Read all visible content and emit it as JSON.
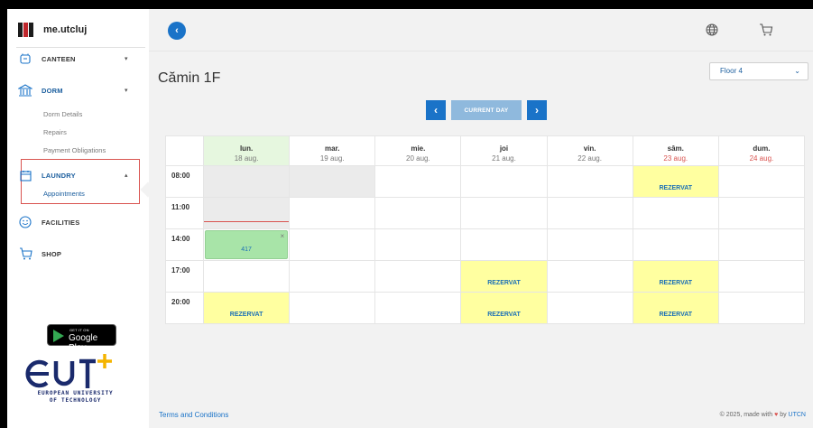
{
  "brand": {
    "name": "me.utcluj"
  },
  "sidebar": {
    "canteen": {
      "label": "CANTEEN"
    },
    "dorm": {
      "label": "DORM",
      "items": [
        "Dorm Details",
        "Repairs",
        "Payment Obligations"
      ]
    },
    "laundry": {
      "label": "LAUNDRY",
      "items": [
        "Appointments"
      ]
    },
    "facilities": {
      "label": "FACILITIES"
    },
    "shop": {
      "label": "SHOP"
    },
    "google_play": {
      "small": "GET IT ON",
      "big": "Google Play"
    },
    "eut": {
      "caption_line1": "EUROPEAN UNIVERSITY",
      "caption_line2": "OF TECHNOLOGY"
    }
  },
  "header": {
    "icons": [
      "back-icon",
      "globe-icon",
      "cart-icon"
    ]
  },
  "page": {
    "title": "Cămin 1F",
    "floor_select": {
      "value": "Floor 4"
    },
    "nav": {
      "current_day": "CURRENT DAY"
    }
  },
  "calendar": {
    "days": [
      {
        "name": "lun.",
        "date": "18 aug."
      },
      {
        "name": "mar.",
        "date": "19 aug."
      },
      {
        "name": "mie.",
        "date": "20 aug."
      },
      {
        "name": "joi",
        "date": "21 aug."
      },
      {
        "name": "vin.",
        "date": "22 aug."
      },
      {
        "name": "sâm.",
        "date": "23 aug."
      },
      {
        "name": "dum.",
        "date": "24 aug."
      }
    ],
    "times": [
      "08:00",
      "11:00",
      "14:00",
      "17:00",
      "20:00"
    ],
    "reserved_label": "REZERVAT",
    "booking": {
      "room": "417",
      "close": "×"
    }
  },
  "footer": {
    "terms": "Terms and Conditions",
    "copy_prefix": "© 2025, made with",
    "copy_by": "by",
    "copy_org": "UTCN"
  },
  "colors": {
    "accent": "#1a73c8",
    "reserved": "#ffffa0",
    "booking": "#a8e4a8",
    "today": "#e6f7df",
    "highlight": "#d9534f"
  }
}
